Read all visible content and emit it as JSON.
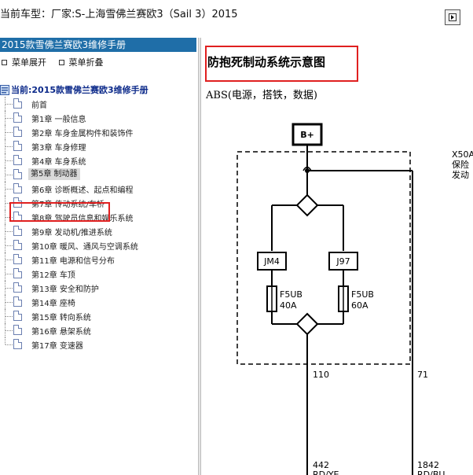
{
  "window": {
    "title": "当前车型：厂家:S-上海雪佛兰赛欧3（Sail 3）2015"
  },
  "sidebar": {
    "manual_title": "2015款雪佛兰赛欧3维修手册",
    "expand_label": "菜单展开",
    "collapse_label": "菜单折叠",
    "root_label": "当前:2015款雪佛兰赛欧3维修手册",
    "items": [
      {
        "label": "前首"
      },
      {
        "label": "第1章 一般信息"
      },
      {
        "label": "第2章 车身金属构件和装饰件"
      },
      {
        "label": "第3章 车身修理"
      },
      {
        "label": "第4章 车身系统"
      },
      {
        "label": "第5章 制动器"
      },
      {
        "label": "第6章 诊断概述、起点和编程"
      },
      {
        "label": "第7章 传动系统/车桥"
      },
      {
        "label": "第8章 驾驶员信息和娱乐系统"
      },
      {
        "label": "第9章 发动机/推进系统"
      },
      {
        "label": "第10章 暖风、通风与空调系统"
      },
      {
        "label": "第11章 电源和信号分布"
      },
      {
        "label": "第12章 车顶"
      },
      {
        "label": "第13章 安全和防护"
      },
      {
        "label": "第14章 座椅"
      },
      {
        "label": "第15章 转向系统"
      },
      {
        "label": "第16章 悬架系统"
      },
      {
        "label": "第17章 变速器"
      }
    ],
    "selected_index": 5
  },
  "document": {
    "title": "防抱死制动系统示意图",
    "subtitle": "ABS(电源，搭铁，数据)"
  },
  "diagram": {
    "battery_label": "B+",
    "block_label_line1": "X50A",
    "block_label_line2": "保险",
    "block_label_line3": "发动",
    "relay_left": "JM4",
    "relay_right": "J97",
    "fuse_left_name": "F5UB",
    "fuse_left_rating": "40A",
    "fuse_right_name": "F5UB",
    "fuse_right_rating": "60A",
    "pin_left": "110",
    "pin_right": "71",
    "wire_left_num": "442",
    "wire_left_color": "RD/YE",
    "wire_right_num": "1842",
    "wire_right_color": "RD/BU"
  },
  "colors": {
    "header_bg": "#1f6ea8",
    "highlight_red": "#e02020",
    "selected_bg": "#d9d9d9"
  }
}
